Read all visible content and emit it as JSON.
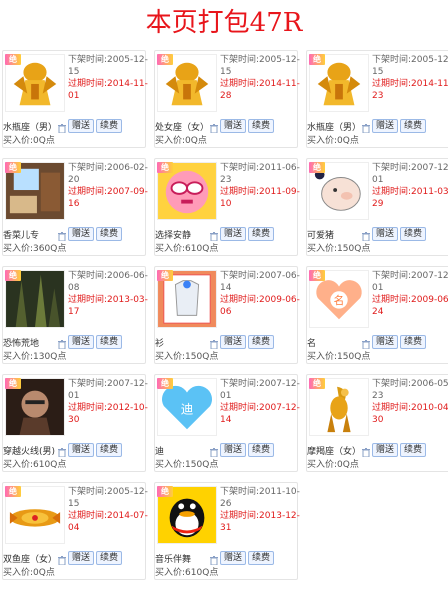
{
  "page": {
    "title": "本页打包47R"
  },
  "labels": {
    "off_prefix": "下架时间:",
    "exp_prefix": "过期时间:",
    "gift_btn": "赠送",
    "renew_btn": "续费",
    "badge": "绝",
    "price_prefix": "买入价:",
    "price_unit": "点"
  },
  "items": [
    {
      "name": "水瓶座（男）",
      "off": "2005-12-15",
      "exp": "2014-11-01",
      "price": "0Q",
      "icon": "gold-armor-figure-icon"
    },
    {
      "name": "处女座（女）",
      "off": "2005-12-15",
      "exp": "2014-11-28",
      "price": "0Q",
      "icon": "gold-armor-figure-icon"
    },
    {
      "name": "水瓶座（男）",
      "off": "2005-12-15",
      "exp": "2014-11-23",
      "price": "0Q",
      "icon": "gold-armor-figure-icon"
    },
    {
      "name": "香菜儿专",
      "off": "2006-02-20",
      "exp": "2007-09-16",
      "price": "360Q",
      "icon": "room-scene-icon"
    },
    {
      "name": "选择安静",
      "off": "2011-06-23",
      "exp": "2011-09-10",
      "price": "610Q",
      "icon": "glasses-face-icon"
    },
    {
      "name": "可爱猪",
      "off": "2007-12-01",
      "exp": "2011-03-29",
      "price": "150Q",
      "icon": "pig-icon"
    },
    {
      "name": "恐怖荒地",
      "off": "2006-06-08",
      "exp": "2013-03-17",
      "price": "130Q",
      "icon": "dark-forest-icon"
    },
    {
      "name": "衫",
      "off": "2007-06-14",
      "exp": "2009-06-06",
      "price": "150Q",
      "icon": "shirt-icon"
    },
    {
      "name": "名",
      "off": "2007-12-01",
      "exp": "2009-06-24",
      "price": "150Q",
      "icon": "name-heart-icon"
    },
    {
      "name": "穿越火线(男)",
      "off": "2007-12-01",
      "exp": "2012-10-30",
      "price": "610Q",
      "icon": "soldier-portrait-icon"
    },
    {
      "name": "迪",
      "off": "2007-12-01",
      "exp": "2007-12-14",
      "price": "150Q",
      "icon": "blue-heart-icon"
    },
    {
      "name": "摩羯座（女）",
      "off": "2006-05-23",
      "exp": "2010-04-30",
      "price": "0Q",
      "icon": "gold-armor-goat-icon"
    },
    {
      "name": "双鱼座（女）",
      "off": "2005-12-15",
      "exp": "2014-07-04",
      "price": "0Q",
      "icon": "gold-fish-armor-icon"
    },
    {
      "name": "音乐伴舞",
      "off": "2011-10-26",
      "exp": "2013-12-31",
      "price": "610Q",
      "icon": "qq-penguin-icon"
    }
  ]
}
